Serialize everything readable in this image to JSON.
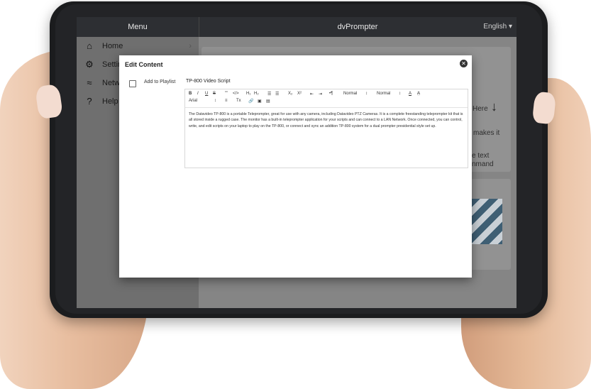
{
  "app": {
    "title": "dvPrompter",
    "menu_header": "Menu",
    "language": "English ▾"
  },
  "sidebar": {
    "items": [
      {
        "label": "Home",
        "icon": "home-icon",
        "glyph": "⌂",
        "chevron": "›"
      },
      {
        "label": "Settir",
        "icon": "gear-icon",
        "glyph": "⚙"
      },
      {
        "label": "Netw",
        "icon": "wifi-icon",
        "glyph": "≈"
      },
      {
        "label": "Help",
        "icon": "help-icon",
        "glyph": "?"
      }
    ]
  },
  "background": {
    "here_text": "Here",
    "arrow": "↓",
    "makes_it": "makes it",
    "e_text": "e text",
    "nmand": "nmand"
  },
  "modal": {
    "title": "Edit Content",
    "close_glyph": "✕",
    "add_to_playlist": "Add to Playlist",
    "script_title": "TP-800 Video Script",
    "toolbar": {
      "bold": "B",
      "italic": "I",
      "underline": "U",
      "strike": "S",
      "quote": "””",
      "code": "</>",
      "h1": "H₁",
      "h2": "H₂",
      "ordered_list": "☰",
      "bullet_list": "☰",
      "subscript": "X₂",
      "superscript": "X²",
      "outdent": "⇤",
      "indent": "⇥",
      "rtl": "•¶",
      "size_select": "Normal",
      "size_caret": "↕",
      "header_select": "Normal",
      "header_caret": "↕",
      "font_color": "A",
      "highlight": "A",
      "font_select": "Arial",
      "font_caret": "↕",
      "align": "≡",
      "clear_format": "Tx",
      "link": "🔗",
      "image": "▣",
      "video": "▤"
    },
    "body_text": "The Datavideo TP-800 is a portable Teleprompter, great for use with any camera, including Datavideo PTZ Cameras. It is a complete freestanding teleprompter kit that is all stored inside a rugged case. The monitor has a built-in teleprompter application for your scripts and can connect to a LAN Network. Once connected, you can control, write, and edit scripts on your laptop to play on the TP-800, or connect and sync an addition TP-800 system for a dual prompter presidential style set up."
  }
}
